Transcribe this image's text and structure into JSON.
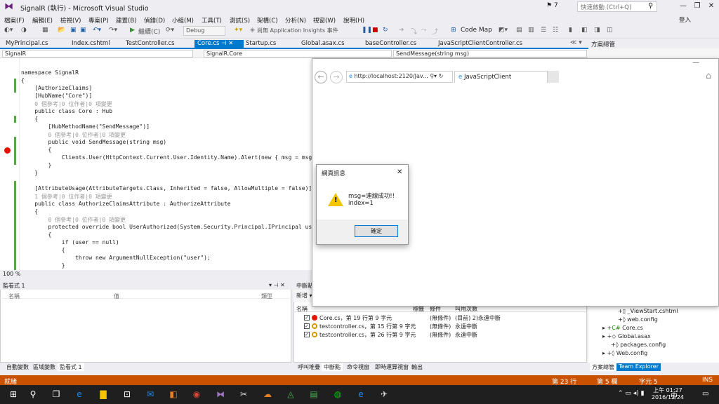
{
  "window": {
    "title": "SignalR (執行) - Microsoft Visual Studio",
    "notification_count": "7",
    "quick_launch_placeholder": "快速啟動 (Ctrl+Q)",
    "sign_in": "登入"
  },
  "menu": [
    "檔案(F)",
    "編輯(E)",
    "檢視(V)",
    "專案(P)",
    "建置(B)",
    "偵錯(D)",
    "小組(M)",
    "工具(T)",
    "測試(S)",
    "架構(C)",
    "分析(N)",
    "視窗(W)",
    "說明(H)"
  ],
  "toolbar": {
    "continue": "繼續(C)",
    "config": "Debug",
    "insights": "尚無 Application Insights 事件",
    "codemap": "Code Map"
  },
  "tabs": [
    "MyPrincipal.cs",
    "Index.cshtml",
    "TestController.cs",
    "Core.cs",
    "Startup.cs",
    "Global.asax.cs",
    "baseController.cs",
    "JavaScriptClientController.cs"
  ],
  "active_tab": "Core.cs",
  "navbar": {
    "project": "SignalR",
    "class": "SignalR.Core",
    "member": "SendMessage(string msg)"
  },
  "code": [
    {
      "t": "namespace SignalR"
    },
    {
      "t": "{"
    },
    {
      "t": "    [AuthorizeClaims]"
    },
    {
      "t": "    [HubName(\"Core\")]"
    },
    {
      "t": "    0 個參考|0 位作者|0 項變更",
      "g": true
    },
    {
      "t": "    public class Core : Hub"
    },
    {
      "t": "    {"
    },
    {
      "t": "        [HubMethodName(\"SendMessage\")]"
    },
    {
      "t": "        0 個參考|0 位作者|0 項變更",
      "g": true
    },
    {
      "t": "        public void SendMessage(string msg)"
    },
    {
      "t": "        {"
    },
    {
      "t": "            Clients.User(HttpContext.Current.User.Identity.Name).Alert(new { msg = msg, index = 1"
    },
    {
      "t": "        }"
    },
    {
      "t": "    }"
    },
    {
      "t": ""
    },
    {
      "t": "    [AttributeUsage(AttributeTargets.Class, Inherited = false, AllowMultiple = false)]"
    },
    {
      "t": "    1 個參考|0 位作者|0 項變更",
      "g": true
    },
    {
      "t": "    public class AuthorizeClaimsAttribute : AuthorizeAttribute"
    },
    {
      "t": "    {"
    },
    {
      "t": "        0 個參考|0 位作者|0 項變更",
      "g": true
    },
    {
      "t": "        protected override bool UserAuthorized(System.Security.Principal.IPrincipal user)"
    },
    {
      "t": "        {"
    },
    {
      "t": "            if (user == null)"
    },
    {
      "t": "            {"
    },
    {
      "t": "                throw new ArgumentNullException(\"user\");"
    },
    {
      "t": "            }"
    }
  ],
  "zoom": "100 %",
  "watch": {
    "title": "監看式 1",
    "col_name": "名稱",
    "col_value": "值",
    "col_type": "類型"
  },
  "bottom_tabs_left": [
    "自動變數",
    "區域變數",
    "監看式 1"
  ],
  "breakpoints": {
    "title": "中斷點",
    "toolbar_new": "新增",
    "columns": [
      "名稱",
      "標籤",
      "條件",
      "叫用次數"
    ],
    "rows": [
      {
        "name": "Core.cs，第 19 行第 9 字元",
        "cond": "(無條件)",
        "hits": "(目前) 2)永遠中斷",
        "active": true
      },
      {
        "name": "testcontroller.cs，第 15 行第 9 字元",
        "cond": "(無條件)",
        "hits": "永遠中斷",
        "active": false
      },
      {
        "name": "testcontroller.cs，第 26 行第 9 字元",
        "cond": "(無條件)",
        "hits": "永遠中斷",
        "active": false
      }
    ]
  },
  "bottom_tabs_mid": [
    "呼叫堆疊",
    "中斷點",
    "命令視窗",
    "即時運算視窗",
    "輸出"
  ],
  "solution": {
    "title": "方案總管",
    "items": [
      "_ViewStart.cshtml",
      "web.config",
      "Core.cs",
      "Global.asax",
      "packages.config",
      "Web.config"
    ],
    "tabs": [
      "方案總管",
      "Team Explorer"
    ]
  },
  "status": {
    "ready": "就緒",
    "line": "第 23 行",
    "col": "第 5 欄",
    "ch": "字元 5",
    "ins": "INS"
  },
  "browser": {
    "url": "http://localhost:2120/Jav...",
    "tab": "JavaScriptClient"
  },
  "dialog": {
    "title": "網頁訊息",
    "line1": "msg=連線成功!!",
    "line2": "index=1",
    "ok": "確定"
  },
  "clock": {
    "time": "上午 01:27",
    "date": "2016/12/24"
  },
  "ime": "中"
}
